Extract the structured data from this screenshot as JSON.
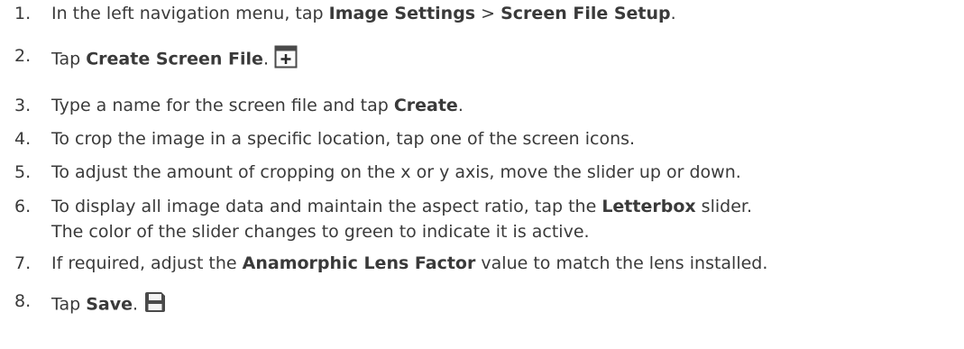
{
  "steps": [
    {
      "num": "1.",
      "parts": [
        {
          "t": "In the left navigation menu, tap "
        },
        {
          "b": "Image Settings"
        },
        {
          "t": " > "
        },
        {
          "b": "Screen File Setup"
        },
        {
          "t": "."
        }
      ]
    },
    {
      "num": "2.",
      "parts": [
        {
          "t": "Tap "
        },
        {
          "b": "Create Screen File"
        },
        {
          "t": "."
        }
      ],
      "icon": "plus-box-icon"
    },
    {
      "num": "3.",
      "parts": [
        {
          "t": "Type a name for the screen file and tap "
        },
        {
          "b": "Create"
        },
        {
          "t": "."
        }
      ]
    },
    {
      "num": "4.",
      "parts": [
        {
          "t": "To crop the image in a specific location, tap one of the screen icons."
        }
      ]
    },
    {
      "num": "5.",
      "parts": [
        {
          "t": "To adjust the amount of cropping on the x or y axis, move the slider up or down."
        }
      ]
    },
    {
      "num": "6.",
      "parts": [
        {
          "t": "To display all image data and maintain the aspect ratio, tap the "
        },
        {
          "b": "Letterbox"
        },
        {
          "t": " slider."
        }
      ],
      "line2": "The color of the slider changes to green to indicate it is active."
    },
    {
      "num": "7.",
      "parts": [
        {
          "t": "If required, adjust the "
        },
        {
          "b": "Anamorphic Lens Factor"
        },
        {
          "t": " value to match the lens installed."
        }
      ]
    },
    {
      "num": "8.",
      "parts": [
        {
          "t": "Tap "
        },
        {
          "b": "Save"
        },
        {
          "t": "."
        }
      ],
      "icon": "save-icon"
    }
  ]
}
